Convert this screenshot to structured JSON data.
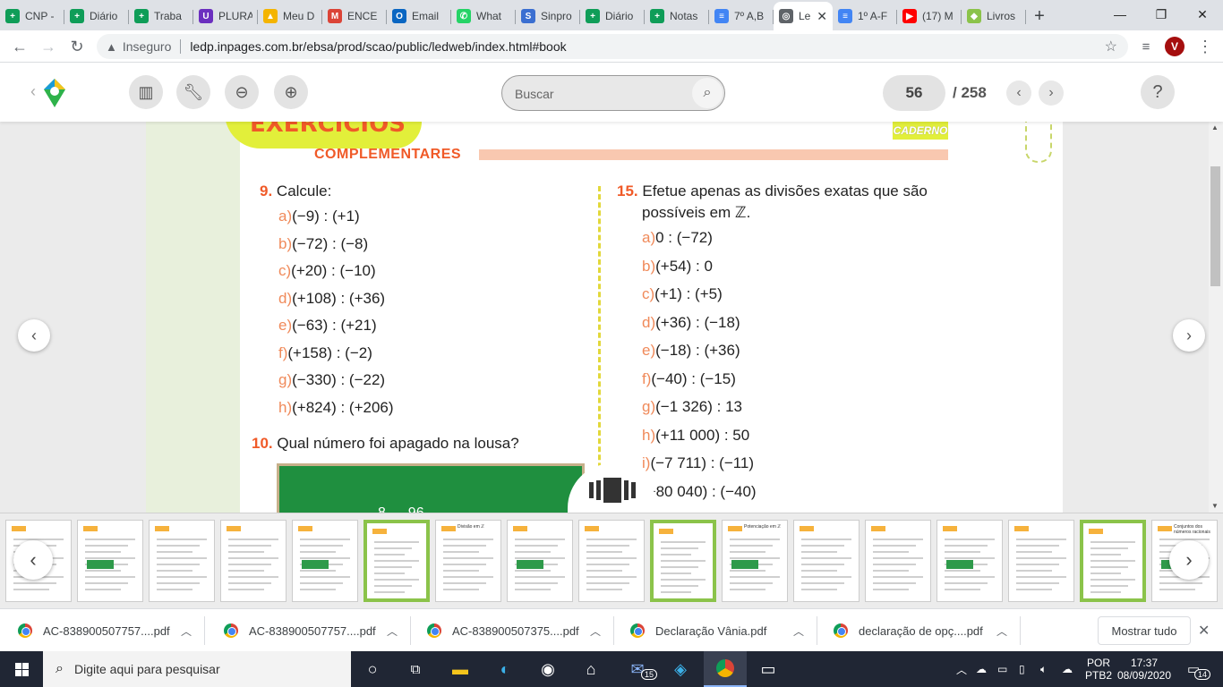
{
  "browser": {
    "tabs": [
      {
        "label": "CNP -",
        "color": "#0f9d58",
        "glyph": "+"
      },
      {
        "label": "Diário",
        "color": "#0f9d58",
        "glyph": "+"
      },
      {
        "label": "Traba",
        "color": "#0f9d58",
        "glyph": "+"
      },
      {
        "label": "PLURA",
        "color": "#6b2fbf",
        "glyph": "U"
      },
      {
        "label": "Meu D",
        "color": "#f4b400",
        "glyph": "▲"
      },
      {
        "label": "ENCE",
        "color": "#db4437",
        "glyph": "M"
      },
      {
        "label": "Email",
        "color": "#0a66c2",
        "glyph": "O"
      },
      {
        "label": "What",
        "color": "#25d366",
        "glyph": "✆"
      },
      {
        "label": "Sinpro",
        "color": "#3b6fd1",
        "glyph": "S"
      },
      {
        "label": "Diário",
        "color": "#0f9d58",
        "glyph": "+"
      },
      {
        "label": "Notas",
        "color": "#0f9d58",
        "glyph": "+"
      },
      {
        "label": "7º A,B",
        "color": "#4285f4",
        "glyph": "≡"
      },
      {
        "label": "Le",
        "color": "#5f6368",
        "glyph": "◎"
      },
      {
        "label": "1º A-F",
        "color": "#4285f4",
        "glyph": "≡"
      },
      {
        "label": "(17) M",
        "color": "#ff0000",
        "glyph": "▶"
      },
      {
        "label": "Livros",
        "color": "#8bc34a",
        "glyph": "◆"
      }
    ],
    "active_tab_index": 12,
    "security_label": "Inseguro",
    "url": "ledp.inpages.com.br/ebsa/prod/scao/public/ledweb/index.html#book",
    "profile_initial": "V"
  },
  "reader": {
    "search_placeholder": "Buscar",
    "current_page": "56",
    "total_pages": "/ 258",
    "help": "?"
  },
  "page": {
    "header_word": "EXERCÍCIOS",
    "section_title": "COMPLEMENTARES",
    "badge": "CADERNO",
    "q9": {
      "number": "9.",
      "prompt": "Calcule:",
      "items": [
        {
          "letter": "a)",
          "expr": "(−9) : (+1)"
        },
        {
          "letter": "b)",
          "expr": "(−72) : (−8)"
        },
        {
          "letter": "c)",
          "expr": "(+20) : (−10)"
        },
        {
          "letter": "d)",
          "expr": "(+108) : (+36)"
        },
        {
          "letter": "e)",
          "expr": "(−63) : (+21)"
        },
        {
          "letter": "f)",
          "expr": "(+158) : (−2)"
        },
        {
          "letter": "g)",
          "expr": "(−330) : (−22)"
        },
        {
          "letter": "h)",
          "expr": "(+824) : (+206)"
        }
      ]
    },
    "q10": {
      "number": "10.",
      "prompt": "Qual número foi apagado na lousa?",
      "board_text": "8 … 96"
    },
    "q15": {
      "number": "15.",
      "prompt_line1": "Efetue apenas as divisões exatas que são",
      "prompt_line2": "possíveis em ℤ.",
      "items": [
        {
          "letter": "a)",
          "expr": "0 : (−72)"
        },
        {
          "letter": "b)",
          "expr": "(+54) : 0"
        },
        {
          "letter": "c)",
          "expr": "(+1) : (+5)"
        },
        {
          "letter": "d)",
          "expr": "(+36) : (−18)"
        },
        {
          "letter": "e)",
          "expr": "(−18) : (+36)"
        },
        {
          "letter": "f)",
          "expr": "(−40) : (−15)"
        },
        {
          "letter": "g)",
          "expr": "(−1 326) : 13"
        },
        {
          "letter": "h)",
          "expr": "(+11 000) : 50"
        },
        {
          "letter": "i)",
          "expr": "(−7 711) : (−11)"
        },
        {
          "letter": "",
          "expr": "(+80 040) : (−40)"
        }
      ]
    }
  },
  "thumbnails": {
    "count": 17,
    "highlighted": [
      5,
      9,
      15
    ],
    "labels": [
      "",
      "",
      "",
      "",
      "",
      "",
      "Divisão em ℤ",
      "",
      "",
      "",
      "Potenciação em ℤ",
      "",
      "",
      "",
      "",
      "",
      "Conjuntos dos números racionais"
    ]
  },
  "downloads": {
    "items": [
      "AC-838900507757....pdf",
      "AC-838900507757....pdf",
      "AC-838900507375....pdf",
      "Declaração Vânia.pdf",
      "declaração de opç....pdf"
    ],
    "show_all": "Mostrar tudo"
  },
  "taskbar": {
    "search_placeholder": "Digite aqui para pesquisar",
    "mail_badge": "15",
    "lang_top": "POR",
    "lang_bottom": "PTB2",
    "time": "17:37",
    "date": "08/09/2020",
    "notif_count": "14"
  }
}
